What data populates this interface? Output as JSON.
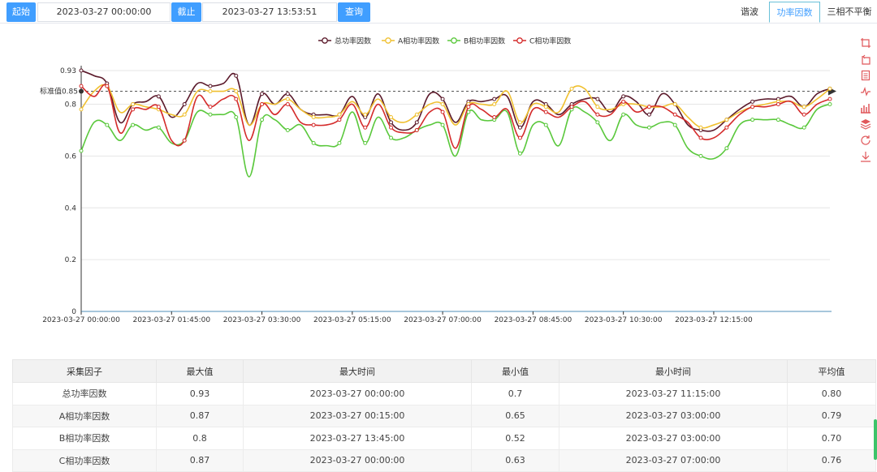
{
  "query": {
    "start_label": "起始",
    "start_value": "2023-03-27 00:00:00",
    "end_label": "截止",
    "end_value": "2023-03-27 13:53:51",
    "search_label": "查询"
  },
  "tabs": [
    {
      "label": "谐波",
      "active": false
    },
    {
      "label": "功率因数",
      "active": true
    },
    {
      "label": "三相不平衡",
      "active": false
    }
  ],
  "toolbox": [
    "crop-icon",
    "undo-icon",
    "data-view-icon",
    "line-chart-icon",
    "bar-chart-icon",
    "stack-icon",
    "refresh-icon",
    "download-icon"
  ],
  "chart_data": {
    "type": "line",
    "title": "",
    "xlabel": "",
    "ylabel": "",
    "ylim": [
      0,
      0.93
    ],
    "yticks": [
      "0",
      "0.2",
      "0.4",
      "0.6",
      "0.8",
      "0.93"
    ],
    "xtick_labels": [
      "2023-03-27 00:00:00",
      "2023-03-27 01:45:00",
      "2023-03-27 03:30:00",
      "2023-03-27 05:15:00",
      "2023-03-27 07:00:00",
      "2023-03-27 08:45:00",
      "2023-03-27 10:30:00",
      "2023-03-27 12:15:00"
    ],
    "x_interval_minutes": 15,
    "x_start": "2023-03-27 00:00:00",
    "x_end": "2023-03-27 13:45:00",
    "reference_line": {
      "label": "标准值0.85",
      "value": 0.85
    },
    "grid": true,
    "legend_position": "top-center",
    "series": [
      {
        "name": "总功率因数",
        "color": "#5b1a2b",
        "values": [
          0.93,
          0.91,
          0.88,
          0.73,
          0.8,
          0.81,
          0.83,
          0.75,
          0.8,
          0.88,
          0.87,
          0.88,
          0.91,
          0.72,
          0.84,
          0.8,
          0.84,
          0.78,
          0.76,
          0.76,
          0.76,
          0.83,
          0.75,
          0.84,
          0.73,
          0.7,
          0.73,
          0.84,
          0.82,
          0.73,
          0.81,
          0.81,
          0.82,
          0.83,
          0.71,
          0.81,
          0.8,
          0.76,
          0.8,
          0.82,
          0.82,
          0.77,
          0.83,
          0.81,
          0.76,
          0.84,
          0.8,
          0.72,
          0.7,
          0.7,
          0.74,
          0.78,
          0.81,
          0.82,
          0.82,
          0.83,
          0.79,
          0.84,
          0.86
        ]
      },
      {
        "name": "A相功率因数",
        "color": "#f0c030",
        "values": [
          0.78,
          0.85,
          0.87,
          0.77,
          0.8,
          0.79,
          0.78,
          0.76,
          0.76,
          0.85,
          0.85,
          0.85,
          0.85,
          0.72,
          0.8,
          0.8,
          0.82,
          0.78,
          0.75,
          0.75,
          0.76,
          0.81,
          0.76,
          0.82,
          0.75,
          0.73,
          0.76,
          0.8,
          0.8,
          0.72,
          0.8,
          0.8,
          0.8,
          0.85,
          0.73,
          0.8,
          0.79,
          0.77,
          0.86,
          0.86,
          0.79,
          0.78,
          0.8,
          0.8,
          0.79,
          0.79,
          0.8,
          0.75,
          0.71,
          0.72,
          0.74,
          0.77,
          0.79,
          0.8,
          0.81,
          0.81,
          0.79,
          0.82,
          0.86
        ]
      },
      {
        "name": "B相功率因数",
        "color": "#5ac83c",
        "values": [
          0.62,
          0.73,
          0.72,
          0.66,
          0.72,
          0.7,
          0.71,
          0.65,
          0.66,
          0.77,
          0.76,
          0.76,
          0.75,
          0.52,
          0.74,
          0.74,
          0.7,
          0.72,
          0.65,
          0.64,
          0.65,
          0.77,
          0.65,
          0.75,
          0.67,
          0.67,
          0.7,
          0.72,
          0.72,
          0.6,
          0.77,
          0.74,
          0.74,
          0.77,
          0.61,
          0.72,
          0.72,
          0.64,
          0.78,
          0.77,
          0.73,
          0.66,
          0.76,
          0.72,
          0.71,
          0.73,
          0.72,
          0.63,
          0.6,
          0.59,
          0.63,
          0.72,
          0.74,
          0.74,
          0.74,
          0.72,
          0.71,
          0.78,
          0.8
        ]
      },
      {
        "name": "C相功率因数",
        "color": "#d42b2b",
        "values": [
          0.87,
          0.83,
          0.87,
          0.69,
          0.78,
          0.78,
          0.79,
          0.66,
          0.66,
          0.83,
          0.79,
          0.82,
          0.82,
          0.66,
          0.8,
          0.76,
          0.8,
          0.73,
          0.72,
          0.72,
          0.74,
          0.8,
          0.71,
          0.8,
          0.71,
          0.69,
          0.7,
          0.77,
          0.77,
          0.63,
          0.79,
          0.78,
          0.75,
          0.78,
          0.67,
          0.78,
          0.77,
          0.75,
          0.79,
          0.81,
          0.76,
          0.76,
          0.81,
          0.77,
          0.79,
          0.79,
          0.76,
          0.73,
          0.67,
          0.67,
          0.71,
          0.76,
          0.79,
          0.79,
          0.8,
          0.81,
          0.76,
          0.8,
          0.82
        ]
      }
    ]
  },
  "table": {
    "headers": [
      "采集因子",
      "最大值",
      "最大时间",
      "最小值",
      "最小时间",
      "平均值"
    ],
    "rows": [
      [
        "总功率因数",
        "0.93",
        "2023-03-27 00:00:00",
        "0.7",
        "2023-03-27 11:15:00",
        "0.80"
      ],
      [
        "A相功率因数",
        "0.87",
        "2023-03-27 00:15:00",
        "0.65",
        "2023-03-27 03:00:00",
        "0.79"
      ],
      [
        "B相功率因数",
        "0.8",
        "2023-03-27 13:45:00",
        "0.52",
        "2023-03-27 03:00:00",
        "0.70"
      ],
      [
        "C相功率因数",
        "0.87",
        "2023-03-27 00:00:00",
        "0.63",
        "2023-03-27 07:00:00",
        "0.76"
      ]
    ]
  }
}
